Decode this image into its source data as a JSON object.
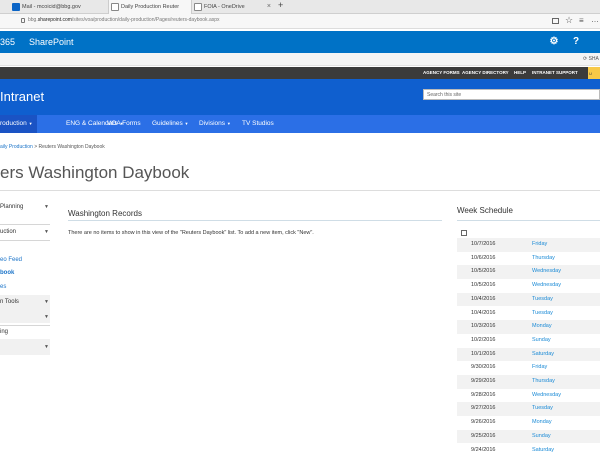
{
  "browser": {
    "tabs": [
      {
        "title": "Mail - mcoicid@bbg.gov",
        "active": false
      },
      {
        "title": "Daily Production Reuter",
        "active": true
      },
      {
        "title": "FOIA - OneDrive",
        "active": false
      }
    ],
    "new_tab_glyph": "+",
    "url_prefix": "bbg.",
    "url_domain": "sharepoint.com",
    "url_path": "/sites/voa/production/daily-production/Pages/reuters-daybook.aspx",
    "icons": [
      "reading-view-icon",
      "favorite-star-icon",
      "hub-icon",
      "settings-more-icon"
    ]
  },
  "suite": {
    "o365_label": "365",
    "app_label": "SharePoint",
    "settings_glyph": "⚙",
    "help_glyph": "?",
    "share_label": "SHA"
  },
  "util_links": [
    "AGENCY FORMS",
    "AGENCY DIRECTORY",
    "HELP",
    "INTRANET SUPPORT"
  ],
  "brand": {
    "title": "Intranet",
    "search_placeholder": "Search this site"
  },
  "nav": [
    {
      "label": "roduction",
      "caret": "▼",
      "active": true
    },
    {
      "label": "ENG & Calendars",
      "caret": "▼",
      "active": false
    },
    {
      "label": "VOA Forms",
      "caret": "",
      "active": false
    },
    {
      "label": "Guidelines",
      "caret": "▼",
      "active": false
    },
    {
      "label": "Divisions",
      "caret": "▼",
      "active": false
    },
    {
      "label": "TV Studios",
      "caret": "",
      "active": false
    }
  ],
  "breadcrumb": {
    "link": "aily Production",
    "separator": ">",
    "current": "Reuters Washington Daybook"
  },
  "page_title": "ers Washington Daybook",
  "left_nav": [
    {
      "label": "Planning",
      "chev": "▼"
    },
    {
      "label": "uction",
      "chev": "▼"
    },
    {
      "label": "eo Feed",
      "chev": ""
    },
    {
      "label": "book",
      "chev": ""
    },
    {
      "label": "es",
      "chev": ""
    },
    {
      "label": "n Tools",
      "chev": "▼"
    },
    {
      "label": "",
      "chev": "▼"
    },
    {
      "label": "ing",
      "chev": ""
    },
    {
      "label": "",
      "chev": "▼"
    }
  ],
  "washington_records": {
    "title": "Washington Records",
    "empty_message": "There are no items to show in this view of the \"Reuters Daybook\" list. To add a new item, click \"New\"."
  },
  "week_schedule": {
    "title": "Week Schedule",
    "rows": [
      {
        "date": "10/7/2016",
        "day": "Friday"
      },
      {
        "date": "10/6/2016",
        "day": "Thursday"
      },
      {
        "date": "10/5/2016",
        "day": "Wednesday"
      },
      {
        "date": "10/5/2016",
        "day": "Wednesday"
      },
      {
        "date": "10/4/2016",
        "day": "Tuesday"
      },
      {
        "date": "10/4/2016",
        "day": "Tuesday"
      },
      {
        "date": "10/3/2016",
        "day": "Monday"
      },
      {
        "date": "10/2/2016",
        "day": "Sunday"
      },
      {
        "date": "10/1/2016",
        "day": "Saturday"
      },
      {
        "date": "9/30/2016",
        "day": "Friday"
      },
      {
        "date": "9/29/2016",
        "day": "Thursday"
      },
      {
        "date": "9/28/2016",
        "day": "Wednesday"
      },
      {
        "date": "9/27/2016",
        "day": "Tuesday"
      },
      {
        "date": "9/26/2016",
        "day": "Monday"
      },
      {
        "date": "9/25/2016",
        "day": "Sunday"
      },
      {
        "date": "9/24/2016",
        "day": "Saturday"
      }
    ]
  },
  "colors": {
    "suite_blue": "#0072c6",
    "brand_blue": "#0f5fcf",
    "nav_blue": "#2b6fe6",
    "link_blue": "#1a8ad6",
    "util_dark": "#3b3b3b"
  }
}
